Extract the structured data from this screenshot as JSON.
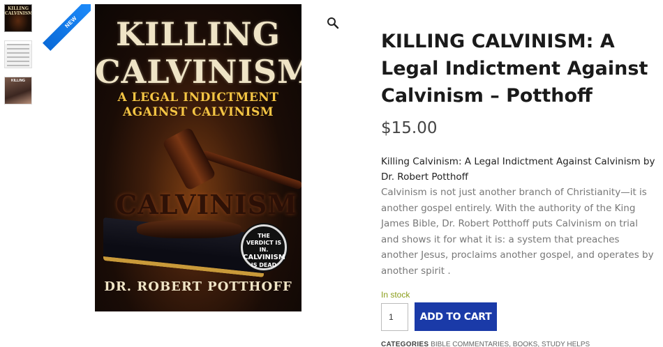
{
  "gallery": {
    "badge": "NEW",
    "thumbnails": [
      {
        "kind": "cover",
        "line1": "KILLING",
        "line2": "CALVINISM"
      },
      {
        "kind": "text"
      },
      {
        "kind": "photo",
        "line1": "KILLING"
      }
    ],
    "cover": {
      "title_line1": "KILLING",
      "title_line2": "CALVINISM",
      "subtitle_line1": "A LEGAL INDICTMENT",
      "subtitle_line2": "AGAINST CALVINISM",
      "background_word": "CALVINISM",
      "seal_line1": "THE",
      "seal_line2": "VERDICT IS IN.",
      "seal_line3": "CALVINISM",
      "seal_line4": "IS DEAD",
      "author": "DR. ROBERT POTTHOFF"
    },
    "zoom_icon": "magnifier-icon"
  },
  "product": {
    "title": "KILLING CALVINISM: A Legal Indictment Against Calvinism – Potthoff",
    "price": "$15.00",
    "description_heading": "Killing Calvinism: A Legal Indictment Against Calvinism by Dr. Robert Potthoff",
    "description_body": "Calvinism is not just another branch of Christianity—it is another gospel entirely. With the authority of the King James Bible, Dr. Robert Potthoff puts Calvinism on trial and shows it for what it is: a system that preaches another Jesus, proclaims another gospel, and operates by another spirit .",
    "stock": "In stock",
    "quantity": "1",
    "add_to_cart": "ADD TO CART",
    "categories_label": "CATEGORIES",
    "categories": "BIBLE COMMENTARIES, BOOKS, STUDY HELPS"
  },
  "colors": {
    "button": "#1a3aa8",
    "stock": "#8a9d1a",
    "badge": "#1f8fff"
  }
}
